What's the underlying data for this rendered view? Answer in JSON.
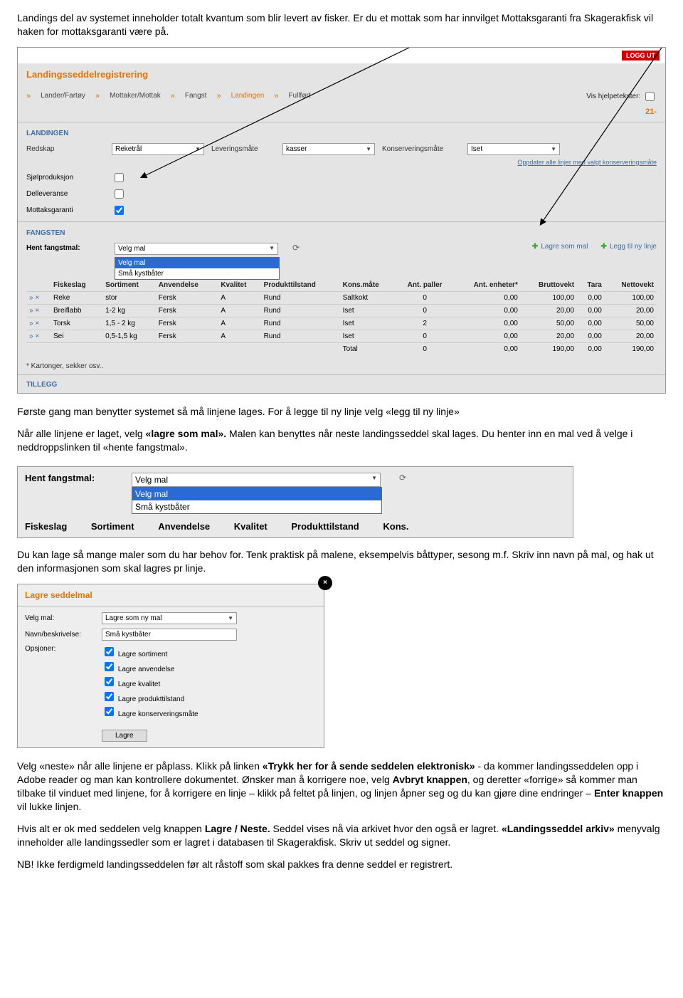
{
  "intro_para": "Landings del av systemet inneholder totalt kvantum som blir levert av fisker. Er du et mottak som har innvilget Mottaksgaranti fra Skagerakfisk vil haken for mottaksgaranti være på.",
  "app": {
    "logout": "LOGG UT",
    "title": "Landingsseddelregistrering",
    "crumbs": [
      "Lander/Fartøy",
      "Mottaker/Mottak",
      "Fangst",
      "Landingen",
      "Fullført"
    ],
    "active_crumb_index": 3,
    "help_label": "Vis hjelpetekster:",
    "page_number": "21-",
    "sections": {
      "landingen": "LANDINGEN",
      "fangsten": "FANGSTEN",
      "tillegg": "TILLEGG"
    },
    "fields": {
      "redskap_label": "Redskap",
      "redskap_value": "Reketrål",
      "lever_label": "Leveringsmåte",
      "lever_value": "kasser",
      "konserv_label": "Konserveringsmåte",
      "konserv_value": "Iset",
      "update_link": "Oppdater alle linjer med valgt konserveringsmåte",
      "sjol_label": "Sjølproduksjon",
      "dellev_label": "Delleveranse",
      "mottak_label": "Mottaksgaranti"
    },
    "hent_label": "Hent fangstmal:",
    "hent_value": "Velg mal",
    "hent_options": [
      "Velg mal",
      "Små kystbåter"
    ],
    "toolbar": {
      "lagre_som_mal": "Lagre som mal",
      "legg_til": "Legg til ny linje"
    },
    "table": {
      "headers": [
        "Fiskeslag",
        "Sortiment",
        "Anvendelse",
        "Kvalitet",
        "Produkttilstand",
        "Kons.måte",
        "Ant. paller",
        "Ant. enheter*",
        "Bruttovekt",
        "Tara",
        "Nettovekt"
      ],
      "rows": [
        {
          "fisk": "Reke",
          "sort": "stor",
          "anv": "Fersk",
          "kval": "A",
          "prod": "Rund",
          "kons": "Saltkokt",
          "paller": "0",
          "enh": "0,00",
          "brutto": "100,00",
          "tara": "0,00",
          "netto": "100,00"
        },
        {
          "fisk": "Breiflabb",
          "sort": "1-2 kg",
          "anv": "Fersk",
          "kval": "A",
          "prod": "Rund",
          "kons": "Iset",
          "paller": "0",
          "enh": "0,00",
          "brutto": "20,00",
          "tara": "0,00",
          "netto": "20,00"
        },
        {
          "fisk": "Torsk",
          "sort": "1,5 - 2 kg",
          "anv": "Fersk",
          "kval": "A",
          "prod": "Rund",
          "kons": "Iset",
          "paller": "2",
          "enh": "0,00",
          "brutto": "50,00",
          "tara": "0,00",
          "netto": "50,00"
        },
        {
          "fisk": "Sei",
          "sort": "0,5-1,5 kg",
          "anv": "Fersk",
          "kval": "A",
          "prod": "Rund",
          "kons": "Iset",
          "paller": "0",
          "enh": "0,00",
          "brutto": "20,00",
          "tara": "0,00",
          "netto": "20,00"
        }
      ],
      "total_label": "Total",
      "total": {
        "paller": "0",
        "enh": "0,00",
        "brutto": "190,00",
        "tara": "0,00",
        "netto": "190,00"
      },
      "footnote": "* Kartonger, sekker osv.."
    }
  },
  "para2_a": "Første gang man benytter systemet så må linjene lages. For å legge til ny linje velg «legg til ny linje»",
  "para2_b_pre": "Når alle linjene er laget, velg ",
  "para2_b_bold": "«lagre som mal».",
  "para2_b_post": " Malen kan benyttes når neste landingsseddel skal lages. Du henter inn en mal ved å velge i neddroppslinken til «hente fangstmal».",
  "mini": {
    "hent_label": "Hent fangstmal:",
    "value": "Velg mal",
    "options": [
      "Velg mal",
      "Små kystbåter"
    ],
    "heads": [
      "Fiskeslag",
      "Sortiment",
      "Anvendelse",
      "Kvalitet",
      "Produkttilstand",
      "Kons."
    ]
  },
  "para3": "Du kan lage så mange maler som du har behov for. Tenk praktisk på malene, eksempelvis båttyper, sesong m.f. Skriv inn navn på mal, og hak ut den informasjonen som skal lagres pr linje.",
  "save": {
    "title": "Lagre seddelmal",
    "velg_label": "Velg mal:",
    "velg_value": "Lagre som ny mal",
    "navn_label": "Navn/beskrivelse:",
    "navn_value": "Små kystbåter",
    "opsjoner_label": "Opsjoner:",
    "opts": [
      "Lagre sortiment",
      "Lagre anvendelse",
      "Lagre kvalitet",
      "Lagre produkttilstand",
      "Lagre konserveringsmåte"
    ],
    "button": "Lagre"
  },
  "para4_a": "Velg «neste» når alle linjene er påplass. Klikk på linken ",
  "para4_bold1": "«Trykk her for å sende seddelen elektronisk»",
  "para4_b": " - da kommer landingsseddelen opp i Adobe reader og man kan kontrollere dokumentet. Ønsker man å korrigere noe, velg ",
  "para4_bold2": "Avbryt knappen",
  "para4_c": ", og deretter «forrige» så kommer man tilbake til vinduet med linjene, for å korrigere en linje – klikk på feltet på linjen, og linjen åpner seg og du kan gjøre dine endringer – ",
  "para4_bold3": "Enter knappen",
  "para4_d": " vil lukke linjen.",
  "para5_a": "Hvis alt er ok med seddelen velg knappen ",
  "para5_bold1": "Lagre / Neste.",
  "para5_b": " Seddel vises nå via arkivet hvor den også er lagret. ",
  "para5_bold2": "«Landingsseddel arkiv»",
  "para5_c": " menyvalg inneholder alle landingssedler som er lagret i databasen til Skagerakfisk. Skriv ut seddel og signer.",
  "para6": "NB! Ikke ferdigmeld landingsseddelen før alt råstoff som skal pakkes fra denne seddel er registrert."
}
